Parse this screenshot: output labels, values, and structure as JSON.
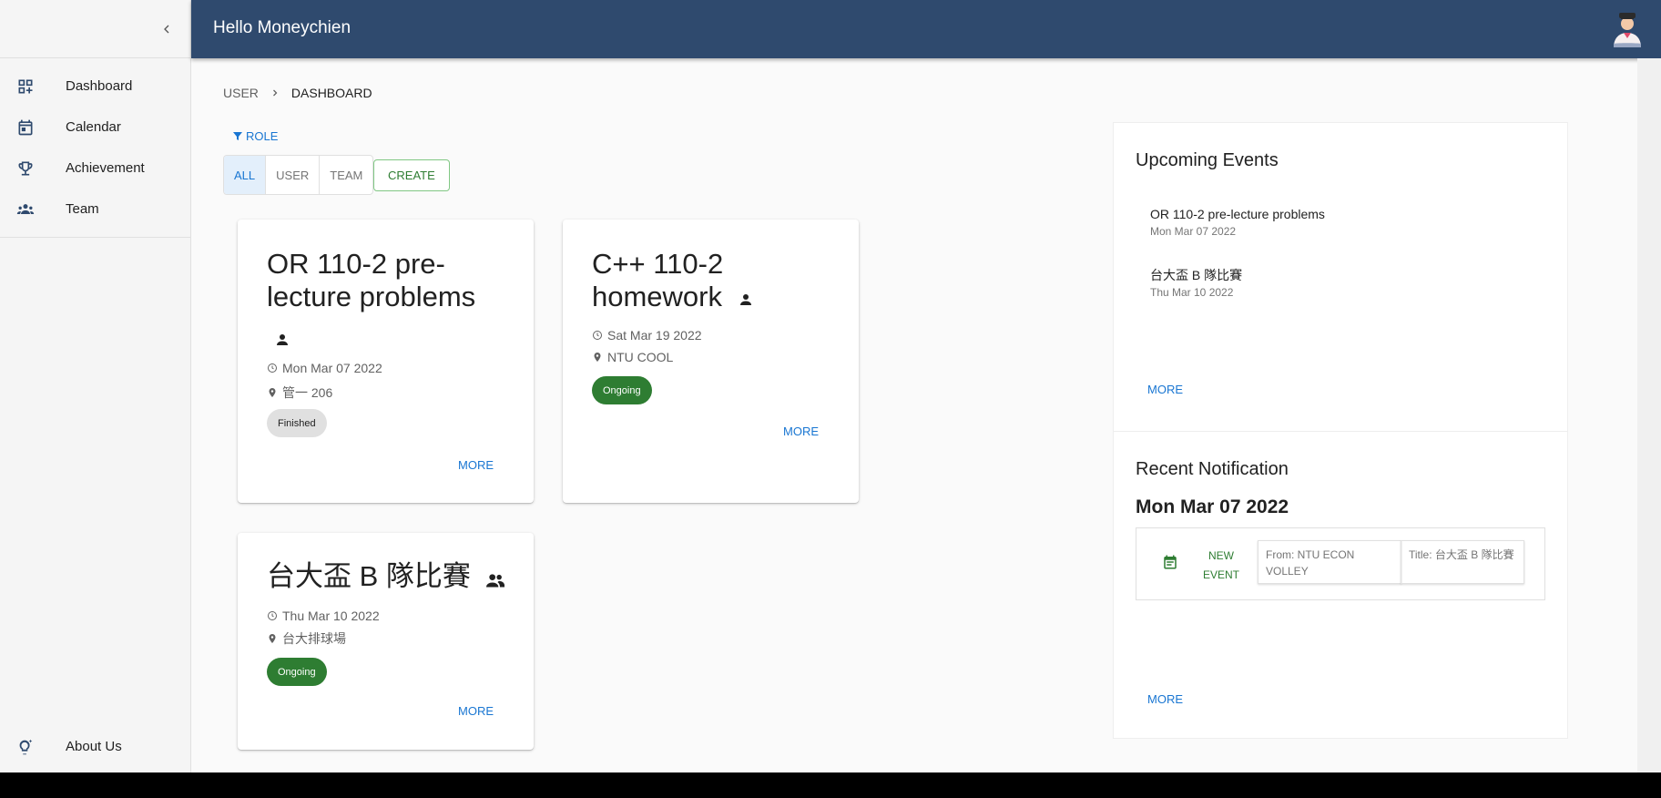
{
  "header": {
    "greeting": "Hello Moneychien"
  },
  "sidebar": {
    "items": [
      {
        "label": "Dashboard",
        "icon": "dashboard-customize-icon"
      },
      {
        "label": "Calendar",
        "icon": "calendar-icon"
      },
      {
        "label": "Achievement",
        "icon": "trophy-icon"
      },
      {
        "label": "Team",
        "icon": "groups-icon"
      }
    ],
    "bottom_item": {
      "label": "About Us",
      "icon": "lightbulb-icon"
    }
  },
  "breadcrumb": [
    "USER",
    "DASHBOARD"
  ],
  "filter": {
    "role_label": "ROLE",
    "toggles": [
      "ALL",
      "USER",
      "TEAM"
    ],
    "selected": "ALL",
    "create_label": "CREATE"
  },
  "cards": [
    {
      "title": "OR 110-2 pre-lecture problems",
      "owner_icon": "person-icon",
      "date": "Mon Mar 07 2022",
      "location": "管一 206",
      "status": "Finished",
      "more_label": "MORE"
    },
    {
      "title": "C++ 110-2 homework",
      "owner_icon": "person-icon",
      "date": "Sat Mar 19 2022",
      "location": "NTU COOL",
      "status": "Ongoing",
      "more_label": "MORE"
    },
    {
      "title": "台大盃 B 隊比賽",
      "owner_icon": "group-icon",
      "date": "Thu Mar 10 2022",
      "location": "台大排球場",
      "status": "Ongoing",
      "more_label": "MORE"
    }
  ],
  "upcoming": {
    "title": "Upcoming Events",
    "events": [
      {
        "name": "OR 110-2 pre-lecture problems",
        "date": "Mon Mar 07 2022"
      },
      {
        "name": "台大盃 B 隊比賽",
        "date": "Thu Mar 10 2022"
      }
    ],
    "more_label": "MORE"
  },
  "notifications": {
    "title": "Recent Notification",
    "date": "Mon Mar 07 2022",
    "items": [
      {
        "type": "NEW EVENT",
        "from": "From: NTU ECON VOLLEY",
        "title": "Title: 台大盃 B 隊比賽"
      }
    ],
    "more_label": "MORE"
  },
  "colors": {
    "appbar": "#2f4a6e",
    "accent": "#1976d2",
    "success": "#2e7d32"
  }
}
